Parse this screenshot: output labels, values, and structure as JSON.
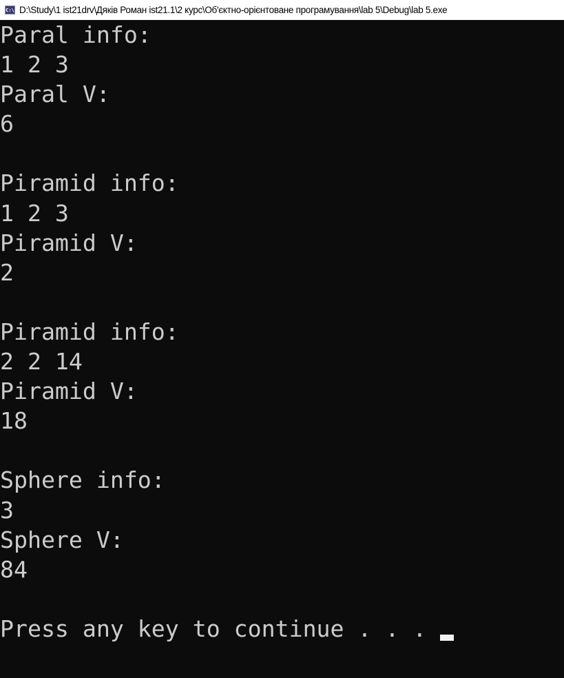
{
  "window": {
    "icon": "console-app-icon",
    "icon_text": "C:\\",
    "title": "D:\\Study\\1 ist21drv\\Дяків Роман ist21.1\\2 курс\\Об'єктно-орієнтоване програмування\\lab 5\\Debug\\lab 5.exe"
  },
  "console": {
    "lines": [
      "Paral info:",
      "1 2 3",
      "Paral V:",
      "6",
      "",
      "Piramid info:",
      "1 2 3",
      "Piramid V:",
      "2",
      "",
      "Piramid info:",
      "2 2 14",
      "Piramid V:",
      "18",
      "",
      "Sphere info:",
      "3",
      "Sphere V:",
      "84",
      "",
      "Press any key to continue . . . "
    ]
  }
}
